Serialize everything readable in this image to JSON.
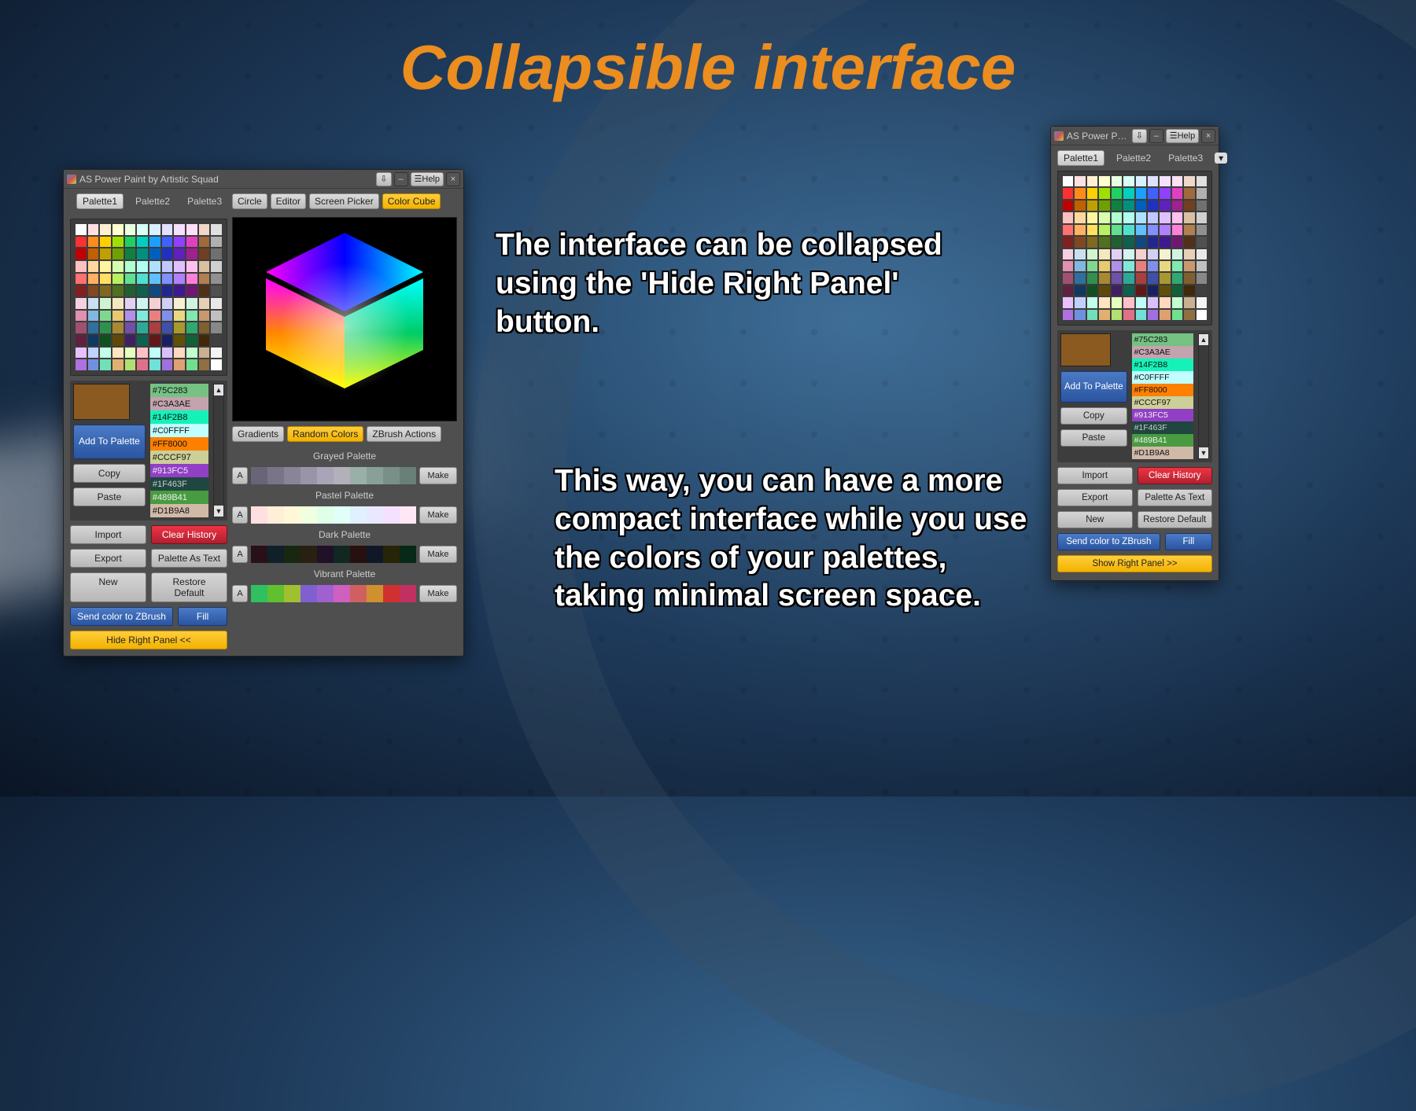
{
  "headline": "Collapsible interface",
  "desc1": "The interface can be collapsed using the 'Hide Right Panel' button.",
  "desc2": "This way, you can have a more compact interface while you use the colors of your palettes, taking minimal screen space.",
  "window": {
    "title_full": "AS Power Paint by Artistic Squad",
    "title_small": "AS Power Pai…",
    "help": "Help"
  },
  "tabs": {
    "p1": "Palette1",
    "p2": "Palette2",
    "p3": "Palette3"
  },
  "modes": {
    "circle": "Circle",
    "editor": "Editor",
    "screen": "Screen Picker",
    "cube": "Color Cube"
  },
  "sub": {
    "gradients": "Gradients",
    "random": "Random Colors",
    "zbrush": "ZBrush Actions"
  },
  "buttons": {
    "add": "Add To Palette",
    "copy": "Copy",
    "paste": "Paste",
    "import": "Import",
    "export": "Export",
    "new": "New",
    "clear": "Clear History",
    "as_text": "Palette As Text",
    "restore": "Restore Default",
    "send": "Send color to ZBrush",
    "fill": "Fill",
    "hide": "Hide Right Panel <<",
    "show": "Show Right Panel >>",
    "make": "Make",
    "a": "A"
  },
  "sections": {
    "grayed": "Grayed Palette",
    "pastel": "Pastel Palette",
    "dark": "Dark Palette",
    "vibrant": "Vibrant Palette"
  },
  "history": [
    {
      "hex": "#75C283",
      "bg": "#75C283",
      "fg": "#111"
    },
    {
      "hex": "#C3A3AE",
      "bg": "#C3A3AE",
      "fg": "#111"
    },
    {
      "hex": "#14F2B8",
      "bg": "#14F2B8",
      "fg": "#111"
    },
    {
      "hex": "#C0FFFF",
      "bg": "#C0FFFF",
      "fg": "#111"
    },
    {
      "hex": "#FF8000",
      "bg": "#FF8000",
      "fg": "#111"
    },
    {
      "hex": "#CCCF97",
      "bg": "#CCCF97",
      "fg": "#111"
    },
    {
      "hex": "#913FC5",
      "bg": "#913FC5",
      "fg": "#eee"
    },
    {
      "hex": "#1F463F",
      "bg": "#1F463F",
      "fg": "#ccc"
    },
    {
      "hex": "#489B41",
      "bg": "#489B41",
      "fg": "#eee"
    },
    {
      "hex": "#D1B9A8",
      "bg": "#D1B9A8",
      "fg": "#111"
    }
  ],
  "current_color": "#8a5a20",
  "palette_grid": [
    "#ffffff",
    "#ffe0e0",
    "#fff0d0",
    "#ffffd0",
    "#e8ffe0",
    "#d8fff6",
    "#d8f0ff",
    "#e0e0ff",
    "#f4e0ff",
    "#ffe0f6",
    "#f0d8c8",
    "#e0e0e0",
    "#ff3030",
    "#ff8c1a",
    "#ffd000",
    "#a0e000",
    "#20d060",
    "#00d0c0",
    "#1aa0ff",
    "#4060ff",
    "#9040ff",
    "#e040c0",
    "#a06a3a",
    "#b0b0b0",
    "#c00000",
    "#c06000",
    "#c0a000",
    "#70a000",
    "#108040",
    "#009080",
    "#0060c0",
    "#2030c0",
    "#6020c0",
    "#a02090",
    "#704020",
    "#707070",
    "#ffc0c0",
    "#ffd8a0",
    "#fff4a0",
    "#d8ffb0",
    "#b0ffd0",
    "#b0fff0",
    "#b0e0ff",
    "#c0c8ff",
    "#e0c0ff",
    "#ffc0f0",
    "#d8c0a0",
    "#d0d0d0",
    "#ff7070",
    "#ffb060",
    "#ffe060",
    "#b8f060",
    "#60e090",
    "#50e0d0",
    "#60c0ff",
    "#8090ff",
    "#b080ff",
    "#ff80d8",
    "#b08050",
    "#909090",
    "#802020",
    "#804820",
    "#806820",
    "#507020",
    "#206030",
    "#106050",
    "#104880",
    "#202890",
    "#401890",
    "#701870",
    "#503018",
    "#505050",
    "#f4d0e0",
    "#c8e0f0",
    "#d0f4d0",
    "#f4e8c0",
    "#e0d0f4",
    "#d0f4f0",
    "#f4d0d0",
    "#d0d0f4",
    "#f4f0d0",
    "#d0f4e0",
    "#e8d0b8",
    "#e8e8e8",
    "#e090b0",
    "#80b8e0",
    "#80d890",
    "#e8c870",
    "#b090e8",
    "#80e8d8",
    "#e88080",
    "#8090e8",
    "#e8d880",
    "#80e8b0",
    "#c89870",
    "#c0c0c0",
    "#a05070",
    "#3070a0",
    "#309050",
    "#a88830",
    "#7050a8",
    "#30a898",
    "#a84040",
    "#4050a8",
    "#a89830",
    "#30a870",
    "#806030",
    "#888888",
    "#602040",
    "#103860",
    "#105020",
    "#604808",
    "#402060",
    "#106050",
    "#601818",
    "#182060",
    "#605008",
    "#106038",
    "#402808",
    "#404040",
    "#e8c0ff",
    "#c0d0ff",
    "#c0ffe8",
    "#ffe4c0",
    "#e4ffc0",
    "#ffc0c8",
    "#c0fff8",
    "#d8c0ff",
    "#ffd8c0",
    "#c0ffd0",
    "#c8b090",
    "#f4f4f4",
    "#b070e0",
    "#7090e0",
    "#70e0b8",
    "#e0b070",
    "#b0e070",
    "#e07088",
    "#70e0d8",
    "#a070e0",
    "#e0a070",
    "#70e090",
    "#907040",
    "#ffffff"
  ],
  "mini_palettes": {
    "grayed": [
      "#6a6478",
      "#7a7488",
      "#8a8498",
      "#9a94a8",
      "#aaa4b8",
      "#b2b0b8",
      "#98b0a8",
      "#88a098",
      "#789088",
      "#688078"
    ],
    "pastel": [
      "#ffe0e0",
      "#ffeed8",
      "#fff8d8",
      "#f0ffe0",
      "#e0ffe8",
      "#e0fff8",
      "#e0f0ff",
      "#e8e8ff",
      "#f4e0ff",
      "#ffe8f4"
    ],
    "dark": [
      "#281018",
      "#102028",
      "#182810",
      "#282010",
      "#201028",
      "#102820",
      "#281010",
      "#101828",
      "#282408",
      "#082818"
    ],
    "vibrant": [
      "#30c060",
      "#60c030",
      "#a0c030",
      "#8060d0",
      "#a060d0",
      "#d060c0",
      "#d06060",
      "#d09030",
      "#d03030",
      "#c03060"
    ]
  }
}
